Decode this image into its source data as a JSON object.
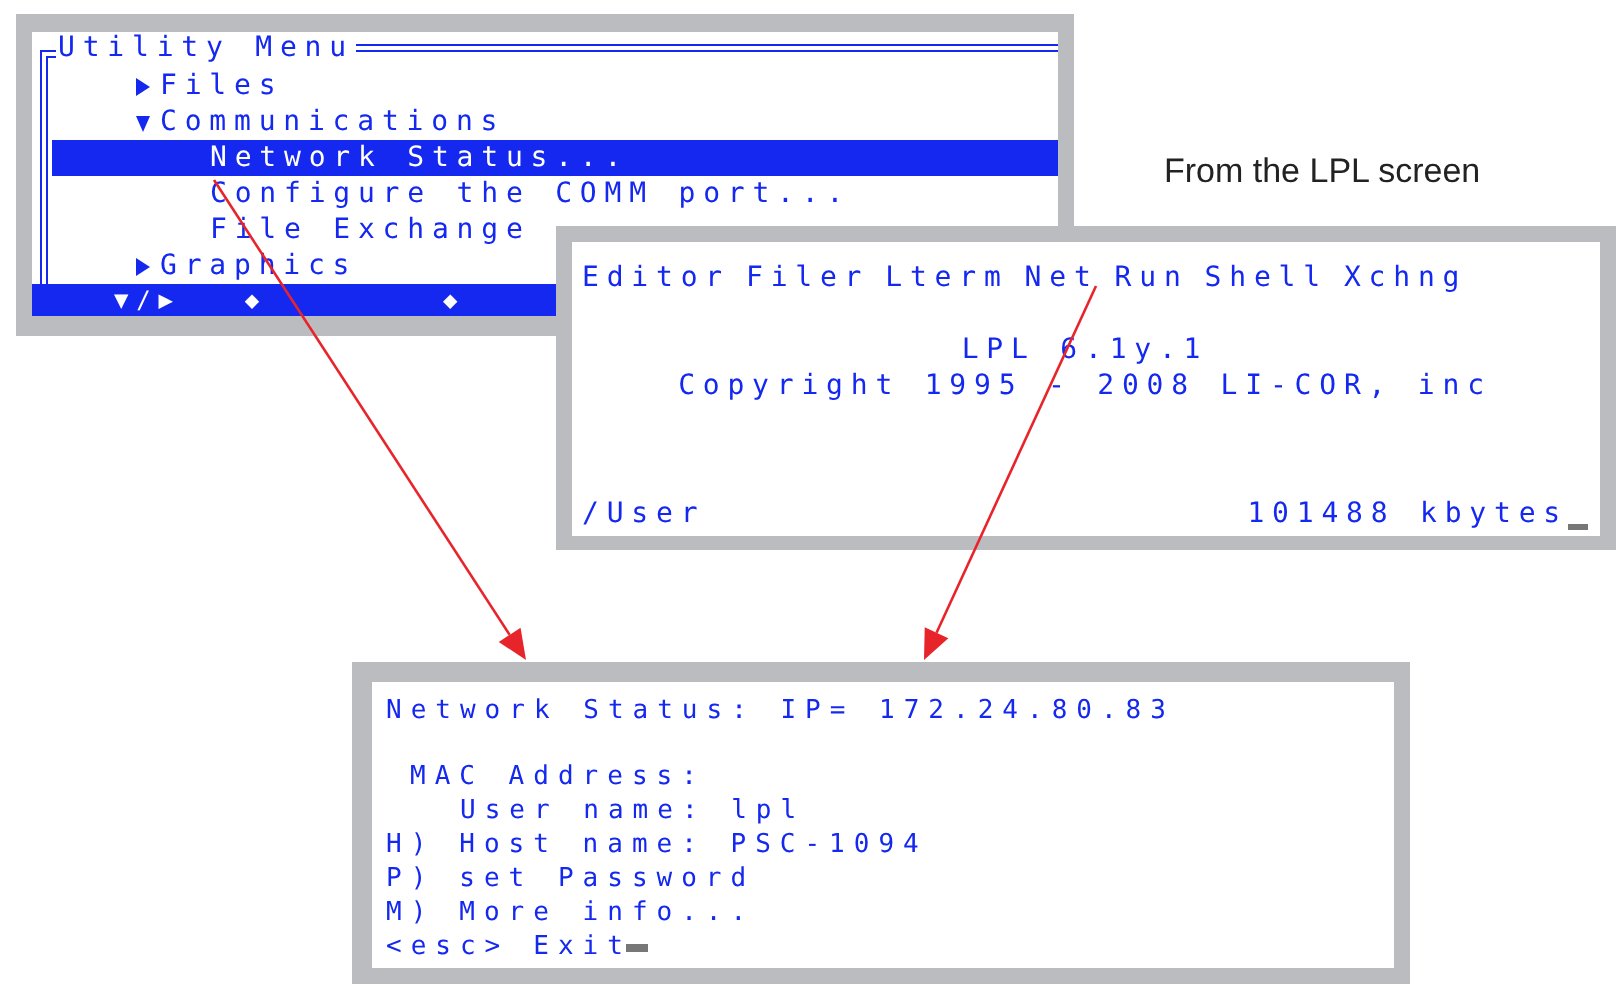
{
  "utility_menu": {
    "title": "Utility Menu",
    "items": [
      {
        "label": "Files",
        "expanded": false,
        "selected": false
      },
      {
        "label": "Communications",
        "expanded": true,
        "selected": false,
        "children": [
          {
            "label": "Network Status...",
            "selected": true
          },
          {
            "label": "Configure the COMM port...",
            "selected": false
          },
          {
            "label": "File Exchange",
            "selected": false
          }
        ]
      },
      {
        "label": "Graphics",
        "expanded": false,
        "selected": false
      }
    ],
    "status_bar": [
      "▼/▶",
      "◆",
      "◆"
    ]
  },
  "caption": "From the LPL screen",
  "lpl_screen": {
    "menu": [
      "Editor",
      "Filer",
      "Lterm",
      "Net",
      "Run",
      "Shell",
      "Xchng"
    ],
    "version": "LPL 6.1y.1",
    "copyright": "Copyright 1995 - 2008 LI-COR, inc",
    "path": "/User",
    "free_memory": "101488 kbytes"
  },
  "network_status": {
    "title": "Network Status: IP= 172.24.80.83",
    "lines": [
      {
        "kind": "heading",
        "text": "MAC Address:"
      },
      {
        "kind": "field",
        "text": "User name: lpl"
      },
      {
        "kind": "option",
        "key": "H)",
        "text": "Host name: PSC-1094"
      },
      {
        "kind": "option",
        "key": "P)",
        "text": "set Password"
      },
      {
        "kind": "option",
        "key": "M)",
        "text": "More info..."
      },
      {
        "kind": "option",
        "key": "<esc>",
        "text": "Exit"
      }
    ]
  }
}
